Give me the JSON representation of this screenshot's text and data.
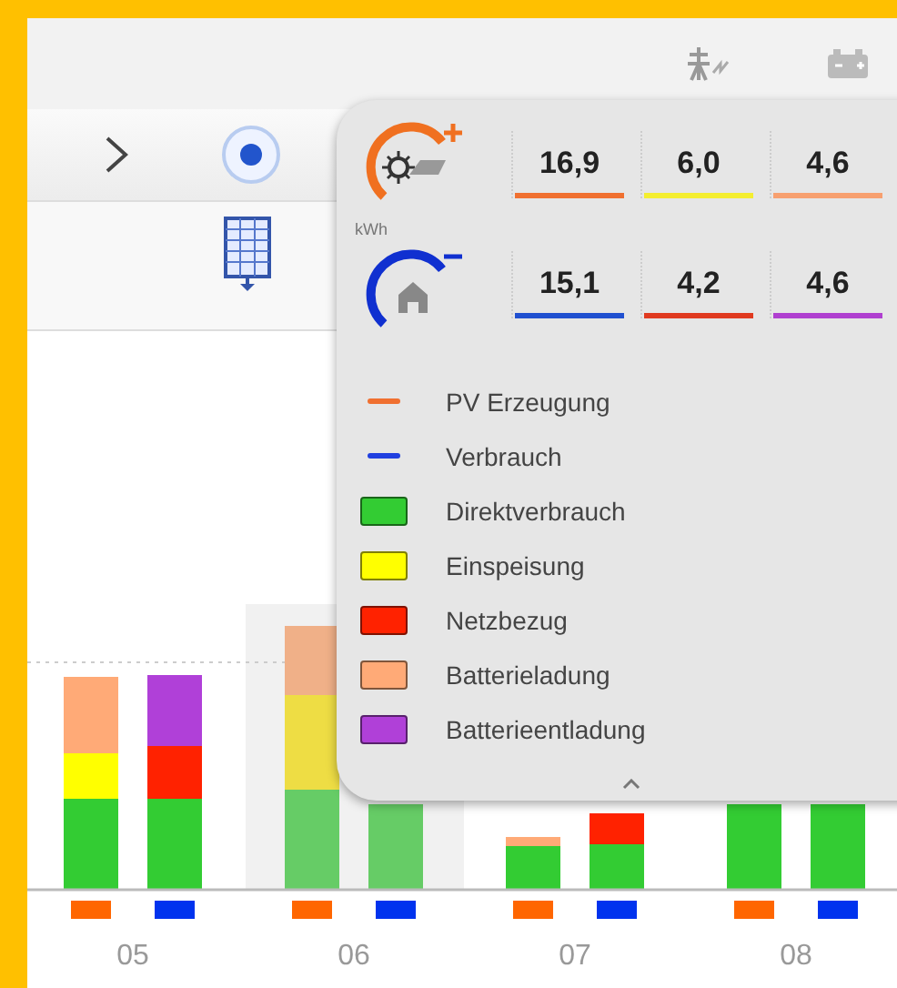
{
  "summary": {
    "unit": "kWh",
    "rows": [
      {
        "kind": "production",
        "values": [
          {
            "text": "16,9",
            "color": "#f07030"
          },
          {
            "text": "6,0",
            "color": "#f4ee30"
          },
          {
            "text": "4,6",
            "color": "#f7a070"
          }
        ]
      },
      {
        "kind": "consumption",
        "values": [
          {
            "text": "15,1",
            "color": "#2050d0"
          },
          {
            "text": "4,2",
            "color": "#e03a20"
          },
          {
            "text": "4,6",
            "color": "#b040d0"
          }
        ]
      }
    ],
    "legend": [
      {
        "kind": "line",
        "label": "PV Erzeugung",
        "color": "#f07030"
      },
      {
        "kind": "line",
        "label": "Verbrauch",
        "color": "#2040e0"
      },
      {
        "kind": "swatch",
        "label": "Direktverbrauch",
        "color": "#33cc33"
      },
      {
        "kind": "swatch",
        "label": "Einspeisung",
        "color": "#ffff00"
      },
      {
        "kind": "swatch",
        "label": "Netzbezug",
        "color": "#ff2200"
      },
      {
        "kind": "swatch",
        "label": "Batterieladung",
        "color": "#ffaa77"
      },
      {
        "kind": "swatch",
        "label": "Batterieentladung",
        "color": "#b040d8"
      }
    ]
  },
  "chart": {
    "categories": [
      "05",
      "06",
      "07",
      "08"
    ]
  }
}
